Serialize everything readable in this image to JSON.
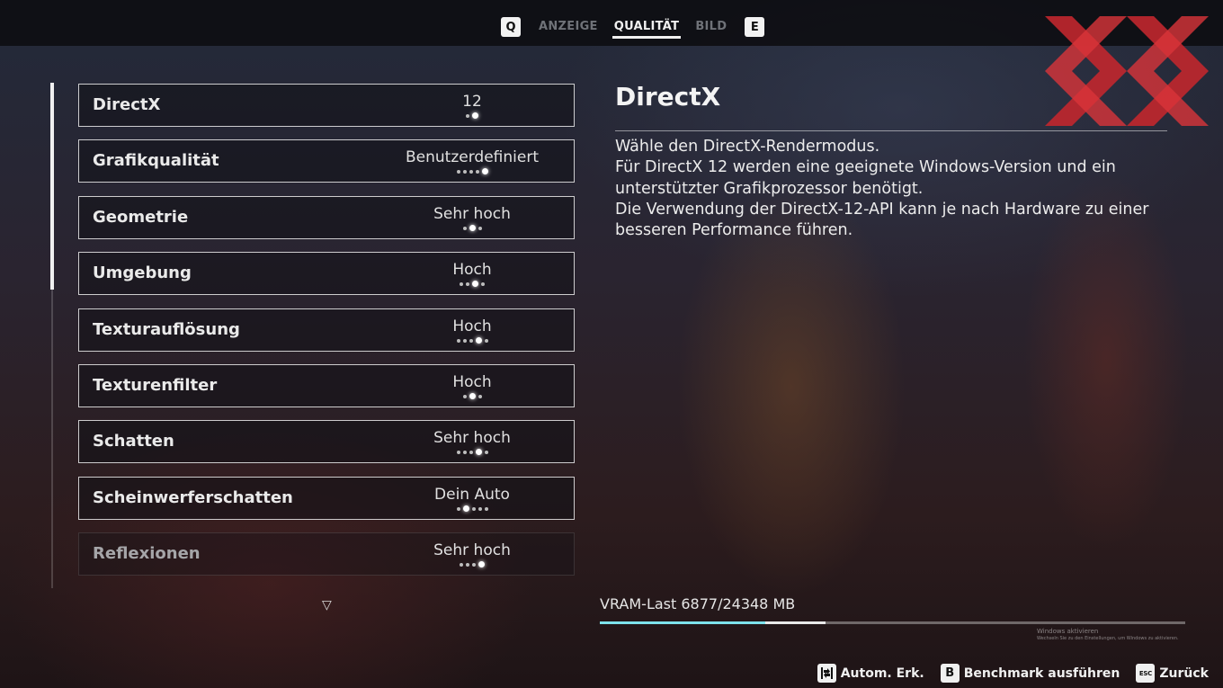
{
  "tabs": {
    "prev_key": "Q",
    "next_key": "E",
    "items": [
      "ANZEIGE",
      "QUALITÄT",
      "BILD"
    ],
    "active": "QUALITÄT"
  },
  "settings": [
    {
      "label": "DirectX",
      "value": "12",
      "options": 2,
      "selected": 2
    },
    {
      "label": "Grafikqualität",
      "value": "Benutzerdefiniert",
      "options": 5,
      "selected": 5
    },
    {
      "label": "Geometrie",
      "value": "Sehr hoch",
      "options": 3,
      "selected": 2
    },
    {
      "label": "Umgebung",
      "value": "Hoch",
      "options": 4,
      "selected": 3
    },
    {
      "label": "Texturauflösung",
      "value": "Hoch",
      "options": 5,
      "selected": 4
    },
    {
      "label": "Texturenfilter",
      "value": "Hoch",
      "options": 3,
      "selected": 2
    },
    {
      "label": "Schatten",
      "value": "Sehr hoch",
      "options": 5,
      "selected": 4
    },
    {
      "label": "Scheinwerferschatten",
      "value": "Dein Auto",
      "options": 5,
      "selected": 2
    },
    {
      "label": "Reflexionen",
      "value": "Sehr hoch",
      "options": 4,
      "selected": 4
    }
  ],
  "scroll_more_icon": "triangle-down-icon",
  "description": {
    "title": "DirectX",
    "lines": [
      "Wähle den DirectX-Rendermodus.",
      "Für DirectX 12 werden eine geeignete Windows-Version und ein",
      "unterstützter Grafikprozessor benötigt.",
      "Die Verwendung der DirectX-12-API kann je nach Hardware zu einer",
      "besseren Performance führen."
    ]
  },
  "vram": {
    "label": "VRAM-Last 6877/24348 MB",
    "used_fraction": 0.2824,
    "projected_fraction": 0.385,
    "fill_color": "#7ee3ec"
  },
  "watermark": {
    "line1": "Windows aktivieren",
    "line2": "Wechseln Sie zu den Einstellungen, um Windows zu aktivieren."
  },
  "logo": {
    "colors": [
      "#c1272d",
      "#d9343a"
    ]
  },
  "footer": [
    {
      "icon": "auto-detect-icon",
      "key": "",
      "label": "Autom. Erk."
    },
    {
      "icon": "b-key-icon",
      "key": "B",
      "label": "Benchmark ausführen"
    },
    {
      "icon": "esc-key-icon",
      "key": "ESC",
      "label": "Zurück"
    }
  ]
}
